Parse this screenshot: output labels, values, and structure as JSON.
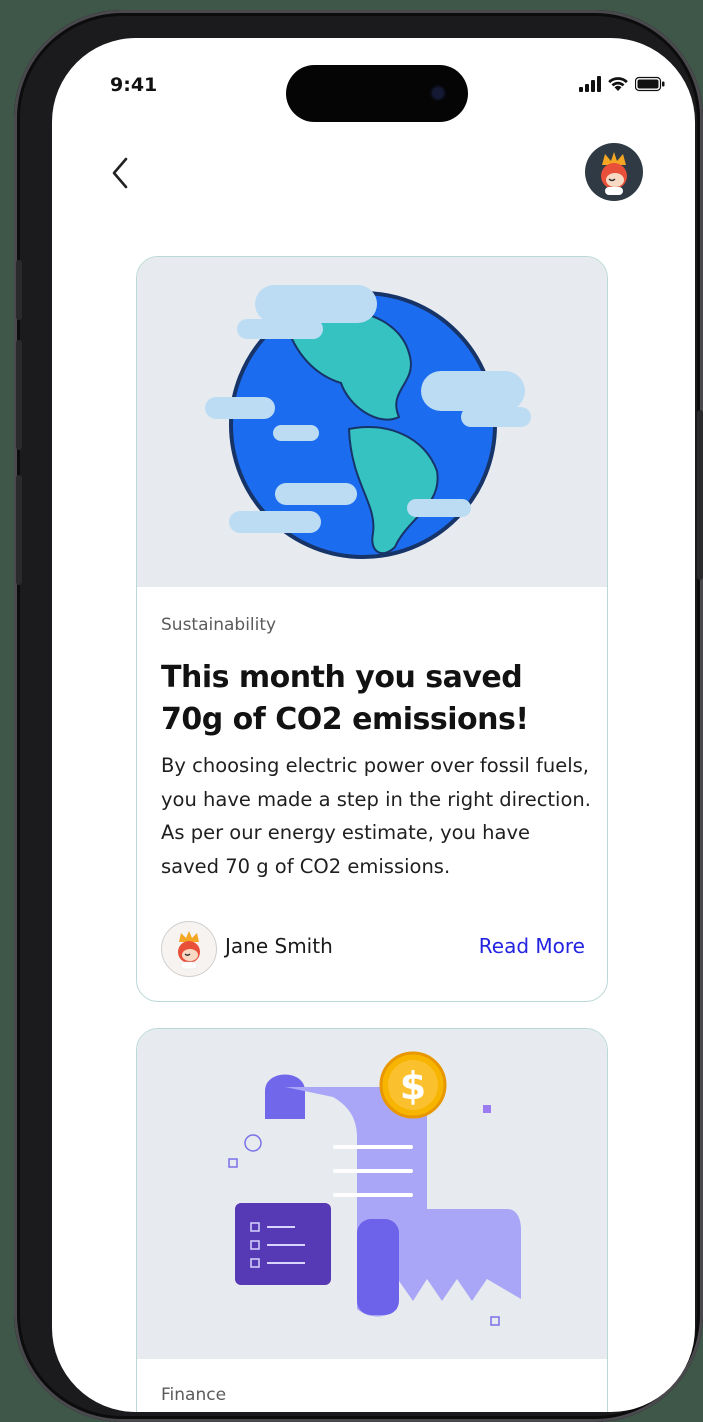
{
  "status_bar": {
    "time": "9:41",
    "icons": [
      "signal-icon",
      "wifi-icon",
      "battery-icon"
    ]
  },
  "nav": {
    "back_icon": "chevron-left-icon",
    "profile_icon": "avatar"
  },
  "cards": [
    {
      "illustration": "earth-with-clouds",
      "category": "Sustainability",
      "headline": "This month you saved 70g of CO2 emissions!",
      "body": "By choosing electric power over fossil fuels, you have made a step in the right direction. As per our energy estimate, you have saved 70 g of CO2 emissions.",
      "author": "Jane Smith",
      "read_more": "Read More"
    },
    {
      "illustration": "receipt-with-dollar-coin",
      "category": "Finance"
    }
  ],
  "colors": {
    "link": "#2323e0",
    "card_border": "#b9d8d6",
    "illustration_bg": "#e7ebef",
    "phone_frame": "#1b1b1d",
    "backdrop": "#3f5748"
  }
}
